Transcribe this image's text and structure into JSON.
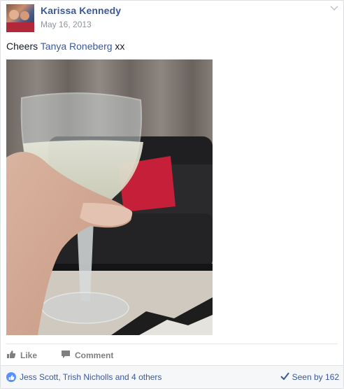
{
  "post": {
    "author_name": "Karissa Kennedy",
    "date": "May 16, 2013",
    "caption_prefix": "Cheers ",
    "caption_mention": "Tanya Roneberg",
    "caption_suffix": " xx"
  },
  "actions": {
    "like_label": "Like",
    "comment_label": "Comment"
  },
  "footer": {
    "likes_text": "Jess Scott, Trish Nicholls and 4 others",
    "seen_text": "Seen by 162"
  },
  "icons": {
    "menu": "chevron-down-icon",
    "like": "thumbs-up-icon",
    "comment": "comment-icon",
    "like_badge": "like-badge-icon",
    "seen": "checkmark-icon"
  },
  "colors": {
    "link": "#3b5998",
    "like_badge": "#5890ff",
    "muted": "#90949c"
  }
}
